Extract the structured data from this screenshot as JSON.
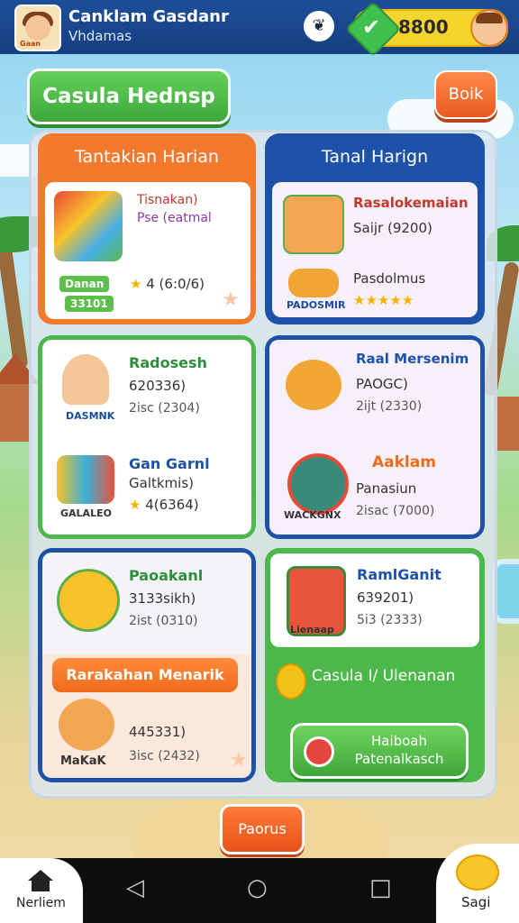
{
  "topbar": {
    "title": "Canklam Gasdanr",
    "subtitle": "Vhdamas",
    "avatar_tag": "Gaan",
    "coins": "8800"
  },
  "header": {
    "page_title": "Casula Hednsp",
    "back_label": "Boik"
  },
  "cards": {
    "daily_left": {
      "heading": "Tantakian Harian",
      "title": "Tisnakan)",
      "line": "Pse (eatmal",
      "badge": "Danan",
      "badge2": "33101",
      "rating": "4 (6:0/6)"
    },
    "daily_right": {
      "heading": "Tanal Harign",
      "title": "Rasalokemaian",
      "line": "Saijr (9200)",
      "label": "Pasdolmus",
      "badge_label": "PADOSMIR",
      "stars": "★★★★★"
    },
    "radoseh": {
      "title": "Radosesh",
      "line": "620336)",
      "small": "2isc (2304)",
      "badge_label": "DASMNK"
    },
    "gan_garnl": {
      "title": "Gan Garnl",
      "line": "Galtkmis)",
      "rating": "4(6364)",
      "badge_label": "GALALEO"
    },
    "raal_mersenim": {
      "title": "Raal Mersenim",
      "line": "PAOGC)",
      "small": "2ijt (2330)"
    },
    "aaklam": {
      "title": "Aaklam",
      "line": "Panasiun",
      "small": "2isac (7000)",
      "badge_label": "WACKGNX"
    },
    "paoakanl": {
      "title": "Paoakanl",
      "line": "3133sikh)",
      "small": "2ist (0310)"
    },
    "ramlganit": {
      "title": "RamlGanit",
      "line": "639201)",
      "small": "5i3 (2333)",
      "badge_label": "Lienaap"
    },
    "makak": {
      "banner": "Rarakahan Menarik",
      "line": "445331)",
      "small": "3isc (2432)",
      "badge_label": "MaKaK"
    }
  },
  "casual_line": "Casula I/ Ulenanan",
  "play_button": {
    "line1": "Haiboah",
    "line2": "Patenalkasch"
  },
  "bonus_label": "Paorus",
  "nav": {
    "home_label": "Nerliem",
    "sagi_label": "Sagi",
    "back_symbol": "◁",
    "home_symbol": "○",
    "recent_symbol": "□"
  },
  "colors": {
    "accent_orange": "#f37a2c",
    "accent_blue": "#1d52a8",
    "accent_green": "#4cb84a"
  }
}
